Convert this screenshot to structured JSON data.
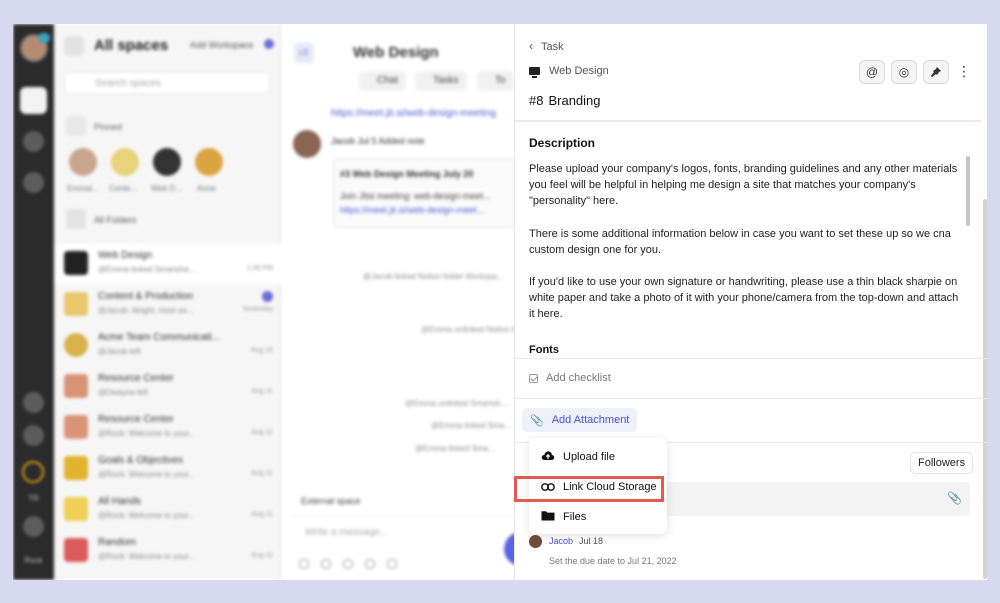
{
  "colors": {
    "accent": "#4b55c9",
    "highlight": "#e35a4f",
    "background": "#d6d9f0"
  },
  "rail": {
    "user_label": "Rock",
    "ring_label": "TR"
  },
  "spaces": {
    "title": "All spaces",
    "add_workspace": "Add Workspace",
    "search_placeholder": "Search spaces",
    "pinned_label": "Pinned",
    "pins": [
      "Emmal...",
      "Conte...",
      "Web D...",
      "Anne"
    ],
    "all_folders": "All Folders",
    "chats": [
      {
        "name": "Web Design",
        "sub": "@Emma linked Smartshe...",
        "time": "1:06 PM"
      },
      {
        "name": "Content & Production",
        "sub": "@Jacob: Alright, most se...",
        "time": "Yesterday"
      },
      {
        "name": "Acme Team Communicati...",
        "sub": "@Jacob left",
        "time": "Aug 16"
      },
      {
        "name": "Resource Center",
        "sub": "@Dwayne left",
        "time": "Aug 11"
      },
      {
        "name": "Resource Center",
        "sub": "@Rock: Welcome to your...",
        "time": "Aug 11"
      },
      {
        "name": "Goals & Objectives",
        "sub": "@Rock: Welcome to your...",
        "time": "Aug 11"
      },
      {
        "name": "All Hands",
        "sub": "@Rock: Welcome to your...",
        "time": "Aug 11"
      },
      {
        "name": "Random",
        "sub": "@Rock: Welcome to your...",
        "time": "Aug 11"
      }
    ]
  },
  "center": {
    "badge": "LE",
    "title": "Web Design",
    "tabs": [
      "Chat",
      "Tasks",
      "To"
    ],
    "link": "https://meet.jit.si/web-design-meeting",
    "msg_name": "Jacob  Jul 5  Added note",
    "card_title": "#3 Web Design Meeting July 20",
    "card_line1": "Join Jitsi meeting: web-design-meet...",
    "card_line2": "https://meet.jit.si/web-design-meet...",
    "sys1": "@Jacob linked Notion folder Workspa...",
    "sys2": "@Emma unlinked Notion folder",
    "sys3": "@Emma unlinked Smartsh...",
    "sys4": "@Emma linked Sma...",
    "sys5": "@Emma linked Sma...",
    "external": "External space",
    "input_placeholder": "Write a message..."
  },
  "panel": {
    "back_label": "Task",
    "workspace": "Web Design",
    "task_number": "#8",
    "task_title": "Branding",
    "description_heading": "Description",
    "description": [
      "Please upload your company's logos, fonts, branding guidelines and any other materials you feel will be helpful in helping me design a site that matches your company's \"personality\" here.",
      "There is some additional information below in case you want to set these up so we cna custom design one for you.",
      "If you'd like to use your own signature or handwriting, please use a thin black sharpie on white paper and take a photo of it with your phone/camera from the top-down and attach it here."
    ],
    "fonts_heading": "Fonts",
    "add_checklist": "Add checklist",
    "add_attachment": "Add Attachment",
    "followers": "Followers",
    "menu": {
      "upload": "Upload file",
      "link_cloud": "Link Cloud Storage",
      "files": "Files"
    },
    "activity": {
      "name": "Jacob",
      "date": "Jul 18",
      "text": "Set the due date to Jul 21, 2022"
    }
  }
}
